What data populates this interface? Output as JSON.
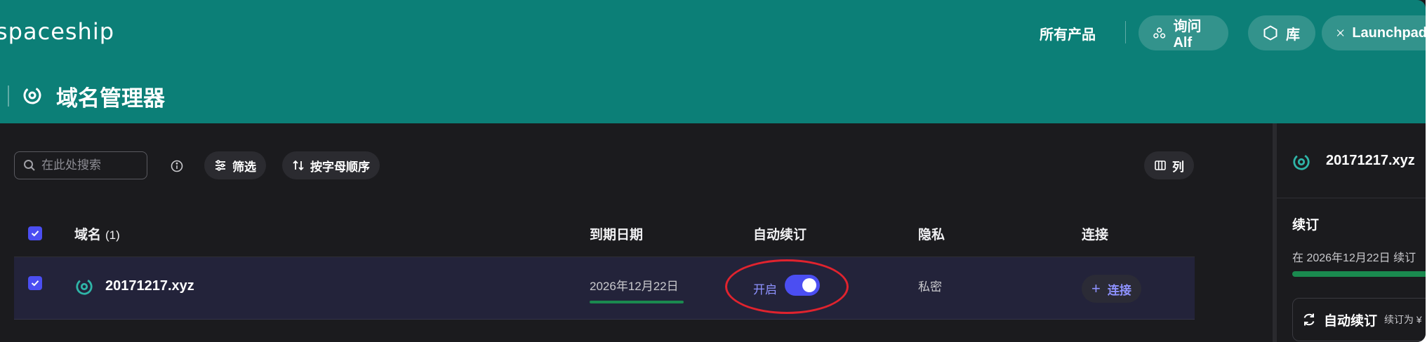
{
  "header": {
    "logo": "spaceship",
    "nav_all_products": "所有产品",
    "ask_alf": "询问 Alf",
    "library": "库",
    "launchpad": "Launchpad",
    "page_title": "域名管理器"
  },
  "toolbar": {
    "search_placeholder": "在此处搜索",
    "filter": "筛选",
    "sort": "按字母顺序",
    "columns": "列"
  },
  "table": {
    "columns": {
      "domain": "域名",
      "domain_count": "(1)",
      "expiry": "到期日期",
      "auto_renew": "自动续订",
      "privacy": "隐私",
      "connect": "连接"
    },
    "rows": [
      {
        "domain": "20171217.xyz",
        "expiry": "2026年12月22日",
        "auto_renew_label": "开启",
        "auto_renew_on": true,
        "privacy": "私密",
        "connect": "连接",
        "checked": true
      }
    ]
  },
  "side_panel": {
    "domain": "20171217.xyz",
    "renew_title": "续订",
    "renew_text": "在 2026年12月22日 续订",
    "auto_renew_title": "自动续订",
    "auto_renew_sub": "续订为 ¥"
  },
  "colors": {
    "brand_teal": "#0c7f77",
    "accent_blue": "#4b4ef2",
    "status_green": "#1a8a4f",
    "highlight_red": "#e0232e"
  }
}
